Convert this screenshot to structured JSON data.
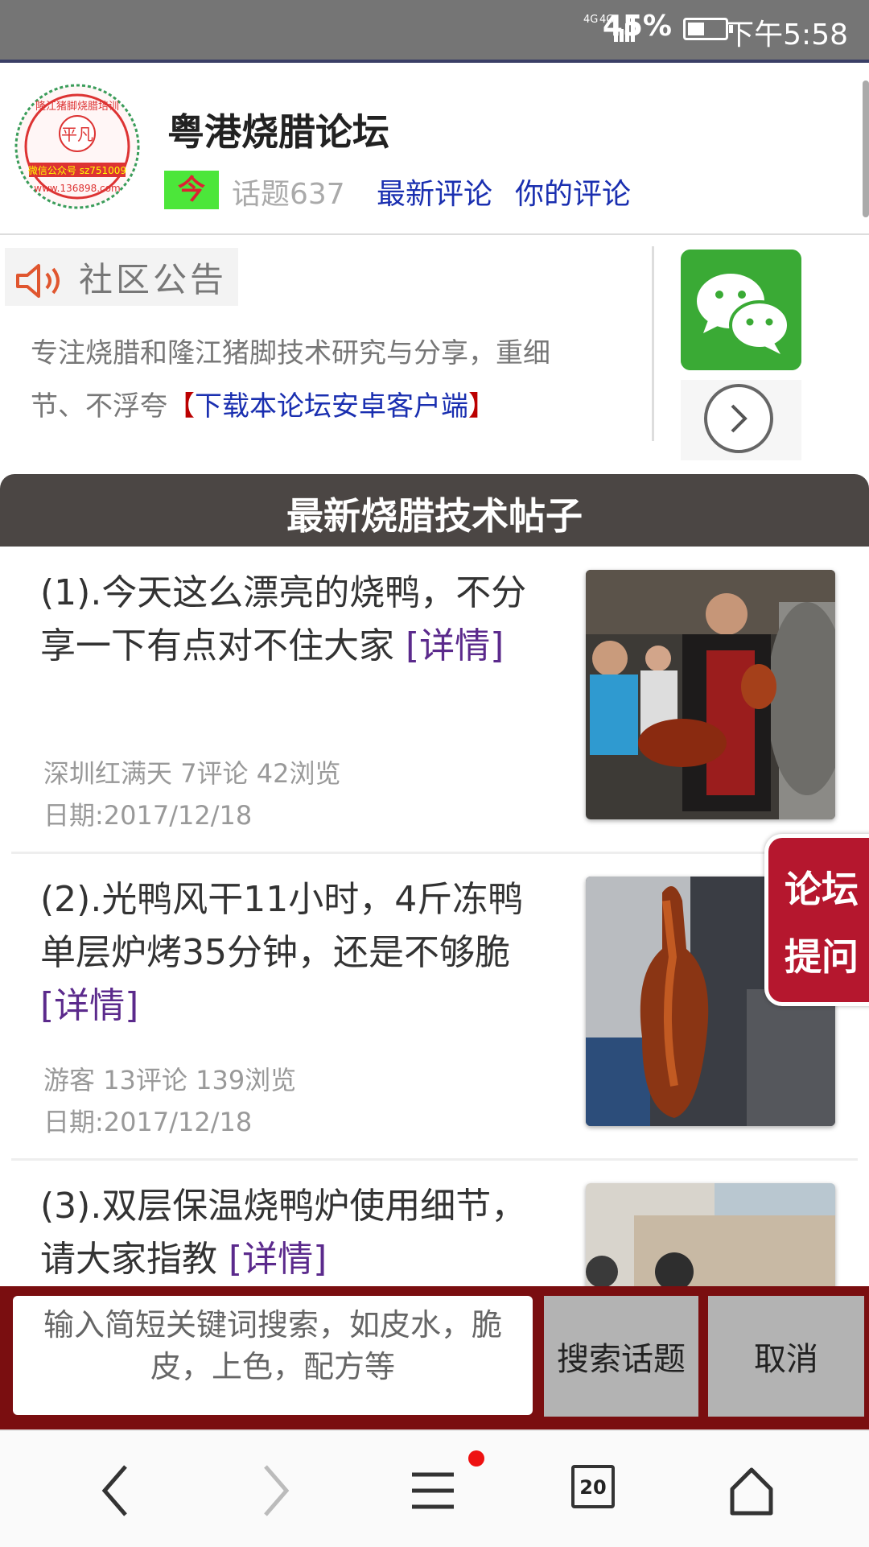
{
  "status_bar": {
    "network": "4G 4G",
    "battery_percent": "45%",
    "battery_level": 0.45,
    "time": "下午5:58"
  },
  "header": {
    "logo_text": [
      "隆江猪脚烧腊培训",
      "平凡",
      "微信公众号 sz751009",
      "www.136898.com"
    ],
    "title": "粤港烧腊论坛",
    "today_badge": "今",
    "topic_count": "话题637",
    "latest_comments": "最新评论",
    "your_comments": "你的评论"
  },
  "notice": {
    "label": "社区公告",
    "text": "专注烧腊和隆江猪脚技术研究与分享，重细节、不浮夸",
    "bracket_open": "【",
    "download_link": "下载本论坛安卓客户端",
    "bracket_close": "】",
    "icons": [
      "speaker-icon",
      "wechat-icon",
      "chevron-right-icon"
    ]
  },
  "section": {
    "title": "最新烧腊技术帖子"
  },
  "posts": [
    {
      "title": "(1).今天这么漂亮的烧鸭，不分享一下有点对不住大家",
      "detail": "[详情]",
      "author": "深圳红满天",
      "comments": "7评论",
      "views": "42浏览",
      "date": "日期:2017/12/18"
    },
    {
      "title": "(2).光鸭风干11小时，4斤冻鸭单层炉烤35分钟，还是不够脆",
      "detail": "[详情]",
      "author": "游客",
      "comments": "13评论",
      "views": "139浏览",
      "date": "日期:2017/12/18"
    },
    {
      "title": "(3).双层保温烧鸭炉使用细节，请大家指教",
      "detail": "[详情]"
    }
  ],
  "ask_button": {
    "line1": "论坛",
    "line2": "提问"
  },
  "search": {
    "placeholder": "输入简短关键词搜索，如皮水，脆皮，上色，配方等",
    "search_button": "搜索话题",
    "cancel_button": "取消"
  },
  "browser_nav": {
    "tab_count": "20",
    "icons": [
      "back-icon",
      "forward-icon",
      "menu-icon",
      "tabs-icon",
      "home-icon"
    ]
  },
  "colors": {
    "banner": "#4b4644",
    "search_bar": "#7a0e10",
    "ask_button": "#b5172e",
    "link": "#1a2fb0",
    "detail_link": "#5b2a8c"
  }
}
